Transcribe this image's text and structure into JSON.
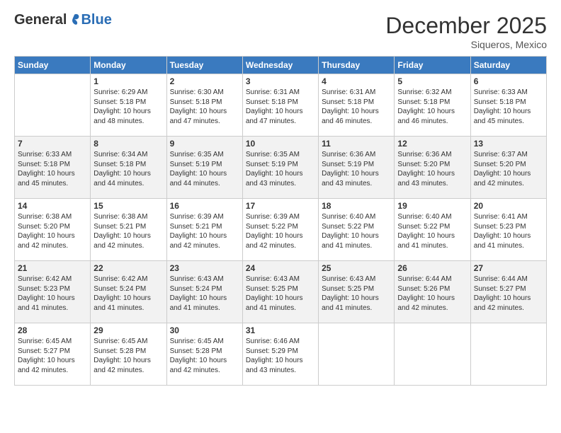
{
  "logo": {
    "general": "General",
    "blue": "Blue"
  },
  "header": {
    "month": "December 2025",
    "location": "Siqueros, Mexico"
  },
  "weekdays": [
    "Sunday",
    "Monday",
    "Tuesday",
    "Wednesday",
    "Thursday",
    "Friday",
    "Saturday"
  ],
  "weeks": [
    [
      {
        "day": "",
        "info": ""
      },
      {
        "day": "1",
        "info": "Sunrise: 6:29 AM\nSunset: 5:18 PM\nDaylight: 10 hours\nand 48 minutes."
      },
      {
        "day": "2",
        "info": "Sunrise: 6:30 AM\nSunset: 5:18 PM\nDaylight: 10 hours\nand 47 minutes."
      },
      {
        "day": "3",
        "info": "Sunrise: 6:31 AM\nSunset: 5:18 PM\nDaylight: 10 hours\nand 47 minutes."
      },
      {
        "day": "4",
        "info": "Sunrise: 6:31 AM\nSunset: 5:18 PM\nDaylight: 10 hours\nand 46 minutes."
      },
      {
        "day": "5",
        "info": "Sunrise: 6:32 AM\nSunset: 5:18 PM\nDaylight: 10 hours\nand 46 minutes."
      },
      {
        "day": "6",
        "info": "Sunrise: 6:33 AM\nSunset: 5:18 PM\nDaylight: 10 hours\nand 45 minutes."
      }
    ],
    [
      {
        "day": "7",
        "info": "Sunrise: 6:33 AM\nSunset: 5:18 PM\nDaylight: 10 hours\nand 45 minutes."
      },
      {
        "day": "8",
        "info": "Sunrise: 6:34 AM\nSunset: 5:18 PM\nDaylight: 10 hours\nand 44 minutes."
      },
      {
        "day": "9",
        "info": "Sunrise: 6:35 AM\nSunset: 5:19 PM\nDaylight: 10 hours\nand 44 minutes."
      },
      {
        "day": "10",
        "info": "Sunrise: 6:35 AM\nSunset: 5:19 PM\nDaylight: 10 hours\nand 43 minutes."
      },
      {
        "day": "11",
        "info": "Sunrise: 6:36 AM\nSunset: 5:19 PM\nDaylight: 10 hours\nand 43 minutes."
      },
      {
        "day": "12",
        "info": "Sunrise: 6:36 AM\nSunset: 5:20 PM\nDaylight: 10 hours\nand 43 minutes."
      },
      {
        "day": "13",
        "info": "Sunrise: 6:37 AM\nSunset: 5:20 PM\nDaylight: 10 hours\nand 42 minutes."
      }
    ],
    [
      {
        "day": "14",
        "info": "Sunrise: 6:38 AM\nSunset: 5:20 PM\nDaylight: 10 hours\nand 42 minutes."
      },
      {
        "day": "15",
        "info": "Sunrise: 6:38 AM\nSunset: 5:21 PM\nDaylight: 10 hours\nand 42 minutes."
      },
      {
        "day": "16",
        "info": "Sunrise: 6:39 AM\nSunset: 5:21 PM\nDaylight: 10 hours\nand 42 minutes."
      },
      {
        "day": "17",
        "info": "Sunrise: 6:39 AM\nSunset: 5:22 PM\nDaylight: 10 hours\nand 42 minutes."
      },
      {
        "day": "18",
        "info": "Sunrise: 6:40 AM\nSunset: 5:22 PM\nDaylight: 10 hours\nand 41 minutes."
      },
      {
        "day": "19",
        "info": "Sunrise: 6:40 AM\nSunset: 5:22 PM\nDaylight: 10 hours\nand 41 minutes."
      },
      {
        "day": "20",
        "info": "Sunrise: 6:41 AM\nSunset: 5:23 PM\nDaylight: 10 hours\nand 41 minutes."
      }
    ],
    [
      {
        "day": "21",
        "info": "Sunrise: 6:42 AM\nSunset: 5:23 PM\nDaylight: 10 hours\nand 41 minutes."
      },
      {
        "day": "22",
        "info": "Sunrise: 6:42 AM\nSunset: 5:24 PM\nDaylight: 10 hours\nand 41 minutes."
      },
      {
        "day": "23",
        "info": "Sunrise: 6:43 AM\nSunset: 5:24 PM\nDaylight: 10 hours\nand 41 minutes."
      },
      {
        "day": "24",
        "info": "Sunrise: 6:43 AM\nSunset: 5:25 PM\nDaylight: 10 hours\nand 41 minutes."
      },
      {
        "day": "25",
        "info": "Sunrise: 6:43 AM\nSunset: 5:25 PM\nDaylight: 10 hours\nand 41 minutes."
      },
      {
        "day": "26",
        "info": "Sunrise: 6:44 AM\nSunset: 5:26 PM\nDaylight: 10 hours\nand 42 minutes."
      },
      {
        "day": "27",
        "info": "Sunrise: 6:44 AM\nSunset: 5:27 PM\nDaylight: 10 hours\nand 42 minutes."
      }
    ],
    [
      {
        "day": "28",
        "info": "Sunrise: 6:45 AM\nSunset: 5:27 PM\nDaylight: 10 hours\nand 42 minutes."
      },
      {
        "day": "29",
        "info": "Sunrise: 6:45 AM\nSunset: 5:28 PM\nDaylight: 10 hours\nand 42 minutes."
      },
      {
        "day": "30",
        "info": "Sunrise: 6:45 AM\nSunset: 5:28 PM\nDaylight: 10 hours\nand 42 minutes."
      },
      {
        "day": "31",
        "info": "Sunrise: 6:46 AM\nSunset: 5:29 PM\nDaylight: 10 hours\nand 43 minutes."
      },
      {
        "day": "",
        "info": ""
      },
      {
        "day": "",
        "info": ""
      },
      {
        "day": "",
        "info": ""
      }
    ]
  ]
}
